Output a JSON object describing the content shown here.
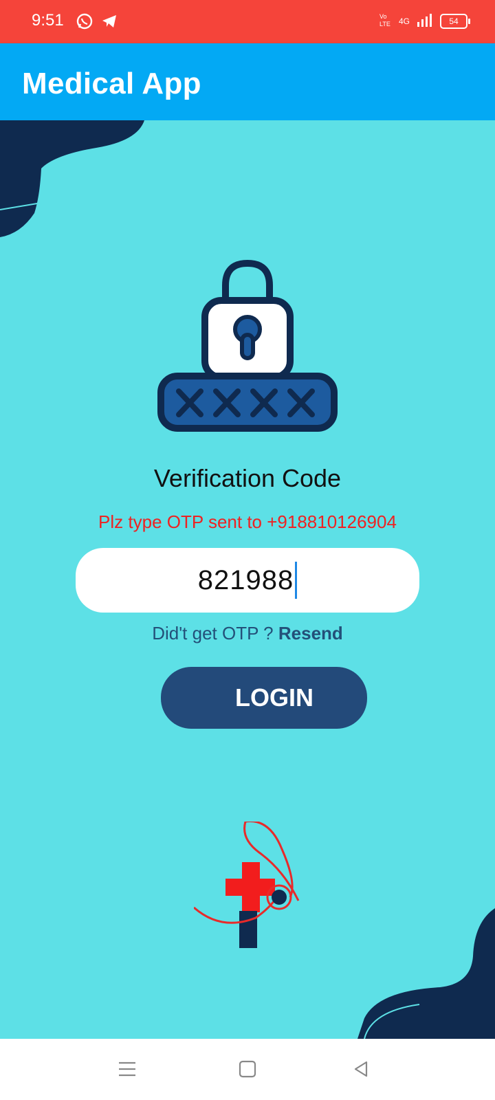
{
  "status_bar": {
    "time": "9:51",
    "network": "4G",
    "battery_level": "54"
  },
  "app_bar": {
    "title": "Medical App"
  },
  "verification": {
    "title": "Verification Code",
    "subtitle": "Plz type OTP sent to +918810126904",
    "otp_value": "821988",
    "resend_prompt": "Did't get OTP ?",
    "resend_label": "Resend",
    "login_label": "LOGIN"
  },
  "icons": {
    "status_left": [
      "whatsapp-icon",
      "telegram-icon"
    ],
    "status_right": [
      "volte-icon",
      "signal-icon",
      "battery-icon"
    ],
    "nav": [
      "menu-icon",
      "home-icon",
      "back-icon"
    ]
  },
  "colors": {
    "status_bar": "#F5443A",
    "app_bar": "#03A9F4",
    "background": "#5DE0E6",
    "accent_dark": "#234A7A",
    "error_text": "#E22"
  }
}
